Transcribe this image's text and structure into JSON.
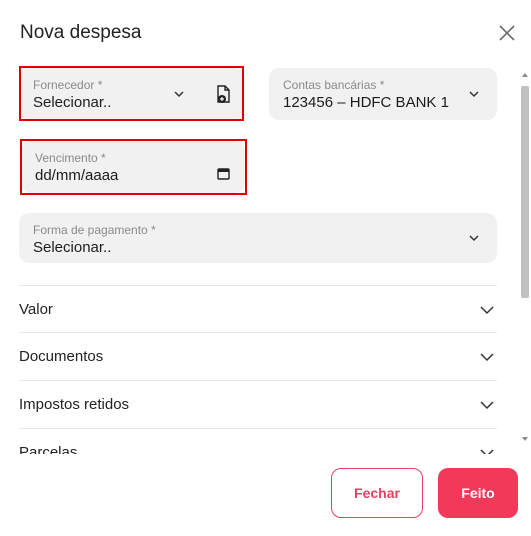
{
  "dialog": {
    "title": "Nova despesa"
  },
  "fields": {
    "supplier": {
      "label": "Fornecedor *",
      "value": "Selecionar.."
    },
    "bank_account": {
      "label": "Contas bancárias *",
      "value": "123456 – HDFC BANK 1"
    },
    "due_date": {
      "label": "Vencimento *",
      "placeholder": "dd/mm/aaaa"
    },
    "payment_method": {
      "label": "Forma de pagamento *",
      "value": "Selecionar.."
    }
  },
  "sections": [
    {
      "label": "Valor"
    },
    {
      "label": "Documentos"
    },
    {
      "label": "Impostos retidos"
    },
    {
      "label": "Parcelas"
    }
  ],
  "buttons": {
    "cancel": "Fechar",
    "done": "Feito"
  },
  "colors": {
    "accent": "#f2395a",
    "highlight": "#e00000",
    "field_bg": "#f1f1f1"
  },
  "icons": {
    "close": "close-icon",
    "chevron": "chevron-down-icon",
    "add_file": "file-add-icon",
    "calendar": "calendar-icon"
  }
}
